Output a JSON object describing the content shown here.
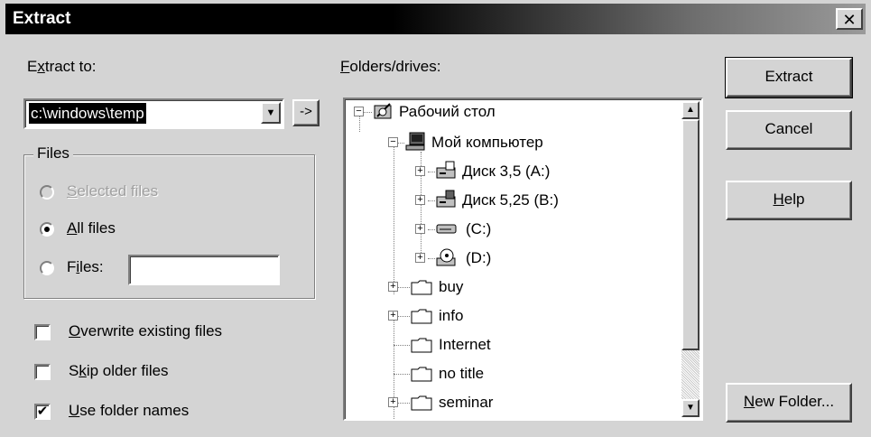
{
  "window": {
    "title": "Extract",
    "close_glyph": "✕"
  },
  "extract_to": {
    "label_pre": "E",
    "label_key": "x",
    "label_post": "tract to:",
    "value": "c:\\windows\\temp",
    "dropdown_glyph": "▼",
    "go_button_label": "->"
  },
  "files_group": {
    "title": "Files",
    "options": [
      {
        "key": "S",
        "rest": "elected files",
        "selected": false,
        "enabled": false
      },
      {
        "key": "A",
        "rest": "ll files",
        "selected": true,
        "enabled": true
      },
      {
        "pre": "F",
        "key": "i",
        "rest": "les:",
        "selected": false,
        "enabled": true
      }
    ],
    "files_input_value": ""
  },
  "checkboxes": [
    {
      "key": "O",
      "rest": "verwrite existing files",
      "checked": false
    },
    {
      "pre": "S",
      "key": "k",
      "rest": "ip older files",
      "checked": false
    },
    {
      "key": "U",
      "rest": "se folder names",
      "checked": true
    }
  ],
  "check_glyph": "✔",
  "folders": {
    "label_key": "F",
    "label_rest": "olders/drives:",
    "expand_glyph": "+",
    "collapse_glyph": "−",
    "tree": [
      {
        "label": "Рабочий стол",
        "icon": "desktop-icon"
      },
      {
        "label": "Мой компьютер",
        "icon": "my-computer-icon"
      },
      {
        "label": "Диск 3,5 (A:)",
        "icon": "floppy-drive-icon"
      },
      {
        "label": "Диск 5,25 (B:)",
        "icon": "floppy-drive-icon"
      },
      {
        "label": "(C:)",
        "icon": "hard-drive-icon"
      },
      {
        "label": "(D:)",
        "icon": "cd-drive-icon"
      },
      {
        "label": "buy",
        "icon": "folder-icon"
      },
      {
        "label": "info",
        "icon": "folder-icon"
      },
      {
        "label": "Internet",
        "icon": "folder-icon"
      },
      {
        "label": "no title",
        "icon": "folder-icon"
      },
      {
        "label": "seminar",
        "icon": "folder-icon"
      }
    ],
    "scroll_up_glyph": "▲",
    "scroll_down_glyph": "▼"
  },
  "buttons": {
    "extract": "Extract",
    "cancel": "Cancel",
    "help_key": "H",
    "help_rest": "elp",
    "new_folder_key": "N",
    "new_folder_rest": "ew Folder..."
  }
}
